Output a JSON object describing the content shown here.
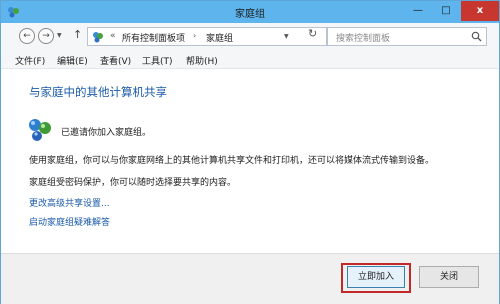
{
  "window": {
    "title": "家庭组",
    "minimize": "—",
    "maximize": "□",
    "close": "x"
  },
  "nav": {
    "back": "←",
    "forward": "→",
    "recent": "▼",
    "up": "↑",
    "prefix": "«",
    "breadcrumb": [
      "所有控制面板项",
      "家庭组"
    ],
    "separator": "›",
    "dropdown": "▼",
    "refresh": "↻",
    "search_placeholder": "搜索控制面板"
  },
  "menu": [
    "文件(F)",
    "编辑(E)",
    "查看(V)",
    "工具(T)",
    "帮助(H)"
  ],
  "content": {
    "heading": "与家庭中的其他计算机共享",
    "invite": "已邀请你加入家庭组。",
    "description1": "使用家庭组，你可以与你家庭网络上的其他计算机共享文件和打印机，还可以将媒体流式传输到设备。",
    "description2": "家庭组受密码保护，你可以随时选择要共享的内容。",
    "links": [
      "更改高级共享设置...",
      "启动家庭组疑难解答"
    ]
  },
  "footer": {
    "join_label": "立即加入",
    "close_label": "关闭"
  },
  "colors": {
    "titlebar": "#5eb5ee",
    "close_button": "#c7372f",
    "heading": "#1a5aa8",
    "highlight": "#c0282a"
  },
  "icons": [
    "homegroup-icon",
    "search-icon"
  ]
}
